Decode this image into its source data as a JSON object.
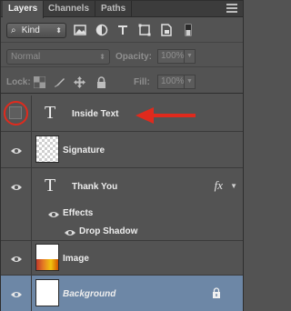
{
  "tabs": [
    {
      "label": "Layers",
      "active": true
    },
    {
      "label": "Channels",
      "active": false
    },
    {
      "label": "Paths",
      "active": false
    }
  ],
  "filter": {
    "kind_label": "Kind",
    "icons": [
      "image-filter-icon",
      "adjustment-filter-icon",
      "type-filter-icon",
      "shape-filter-icon",
      "smart-object-filter-icon",
      "filter-toggle-icon"
    ]
  },
  "blend": {
    "mode": "Normal",
    "opacity_label": "Opacity:",
    "opacity_value": "100%",
    "fill_label": "Fill:",
    "fill_value": "100%",
    "lock_label": "Lock:"
  },
  "layers": [
    {
      "name": "Inside Text",
      "kind": "type",
      "visible": false,
      "italic": false
    },
    {
      "name": "Signature",
      "kind": "pixel",
      "visible": true,
      "italic": false
    },
    {
      "name": "Thank You",
      "kind": "type",
      "visible": true,
      "italic": false,
      "fx": "fx"
    },
    {
      "name": "Effects",
      "kind": "effects-group",
      "visible": true
    },
    {
      "name": "Drop Shadow",
      "kind": "effect",
      "visible": true
    },
    {
      "name": "Image",
      "kind": "image",
      "visible": true,
      "italic": false
    },
    {
      "name": "Background",
      "kind": "background",
      "visible": true,
      "italic": true,
      "selected": true,
      "locked": true
    }
  ],
  "colors": {
    "panel": "#535353",
    "selected_row": "#6d87a6",
    "annotation_red": "#e02a1d"
  },
  "type_glyph": "T",
  "fx_glyph": "fx"
}
